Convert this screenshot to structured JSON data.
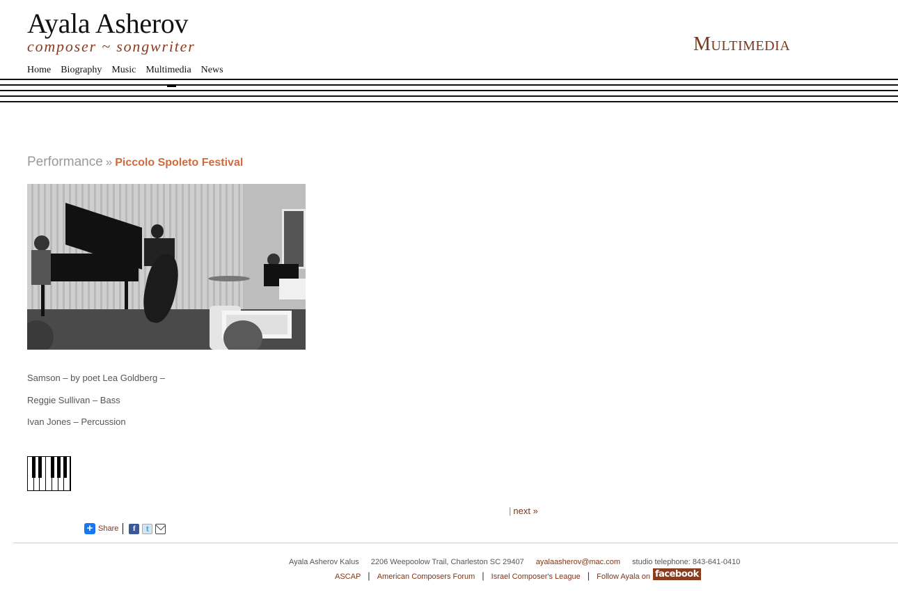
{
  "header": {
    "site_title": "Ayala Asherov",
    "site_subtitle": "composer ~ songwriter",
    "page_heading": "Multimedia"
  },
  "nav": {
    "items": [
      "Home",
      "Biography",
      "Music",
      "Multimedia",
      "News"
    ],
    "active": "Multimedia"
  },
  "breadcrumb": {
    "parent": "Performance",
    "separator": "»",
    "current": "Piccolo Spoleto Festival"
  },
  "photo": {
    "alt": "Black and white photo of a jazz trio performing: pianist, bassist and percussionist"
  },
  "credits": [
    "Samson – by poet Lea Goldberg –",
    "Reggie Sullivan – Bass",
    "Ivan Jones – Percussion"
  ],
  "icons": {
    "piano": "piano-keys-icon"
  },
  "pager": {
    "separator": "|",
    "next_label": "next »"
  },
  "share": {
    "label": "Share",
    "plus": "+",
    "facebook": "f",
    "twitter": "t",
    "email": ""
  },
  "footer": {
    "name": "Ayala Asherov Kalus",
    "address": "2206 Weepoolow Trail, Charleston SC 29407",
    "email": "ayalaasherov@mac.com",
    "phone": "studio telephone: 843-641-0410",
    "links": [
      "ASCAP",
      "American Composers Forum",
      "Israel Composer's League"
    ],
    "follow_label": "Follow Ayala on",
    "facebook_badge": "facebook",
    "pipe": "|"
  },
  "colors": {
    "accent_brown": "#7e3518",
    "accent_orange": "#cf6a3c",
    "staff_lines": "#111111"
  }
}
